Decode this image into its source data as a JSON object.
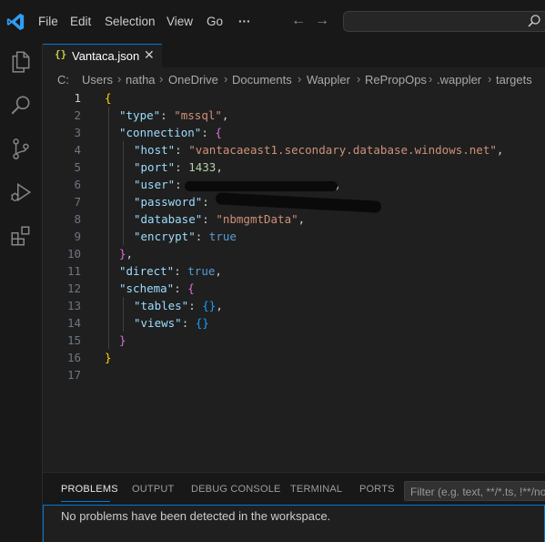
{
  "menu": {
    "file": "File",
    "edit": "Edit",
    "selection": "Selection",
    "view": "View",
    "go": "Go",
    "more": "···"
  },
  "nav": {
    "back": "←",
    "forward": "→"
  },
  "tab": {
    "icon": "{}",
    "label": "Vantaca.json",
    "close": "✕"
  },
  "breadcrumb": [
    "C:",
    "Users",
    "natha",
    "OneDrive",
    "Documents",
    "Wappler",
    "RePropOps",
    ".wappler",
    "targets"
  ],
  "editor": {
    "line_numbers": [
      "1",
      "2",
      "3",
      "4",
      "5",
      "6",
      "7",
      "8",
      "9",
      "10",
      "11",
      "12",
      "13",
      "14",
      "15",
      "16",
      "17"
    ],
    "active_line": 1,
    "tokens": {
      "type_key": "\"type\"",
      "type_val": "\"mssql\"",
      "connection_key": "\"connection\"",
      "host_key": "\"host\"",
      "host_val": "\"vantacaeast1.secondary.database.windows.net\"",
      "port_key": "\"port\"",
      "port_val": "1433",
      "user_key": "\"user\"",
      "password_key": "\"password\"",
      "database_key": "\"database\"",
      "database_val": "\"nbmgmtData\"",
      "encrypt_key": "\"encrypt\"",
      "encrypt_val": "true",
      "direct_key": "\"direct\"",
      "direct_val": "true",
      "schema_key": "\"schema\"",
      "tables_key": "\"tables\"",
      "views_key": "\"views\""
    }
  },
  "panel": {
    "tabs": [
      "PROBLEMS",
      "OUTPUT",
      "DEBUG CONSOLE",
      "TERMINAL",
      "PORTS"
    ],
    "filter_placeholder": "Filter (e.g. text, **/*.ts, !**/no",
    "message": "No problems have been detected in the workspace."
  },
  "colors": {
    "accent": "#0078d4",
    "background": "#1f1f1f",
    "key": "#9cdcfe",
    "string": "#ce9178",
    "number": "#b5cea8",
    "boolean": "#569cd6"
  },
  "icons": [
    "vscode-logo-icon",
    "search-icon",
    "explorer-icon",
    "search-view-icon",
    "source-control-icon",
    "run-debug-icon",
    "extensions-icon",
    "json-file-icon",
    "close-icon"
  ]
}
